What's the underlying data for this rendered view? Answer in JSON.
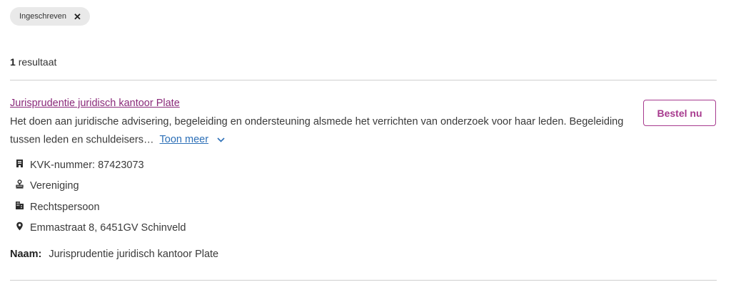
{
  "filter_chip": {
    "label": "Ingeschreven",
    "remove_symbol": "✕"
  },
  "results": {
    "count": "1",
    "label": "resultaat"
  },
  "result": {
    "title": "Jurisprudentie juridisch kantoor Plate",
    "description": "Het doen aan juridische advisering, begeleiding en ondersteuning alsmede het verrichten van onderzoek voor haar leden. Begeleiding tussen leden en schuldeisers…",
    "toon_meer": "Toon meer",
    "order_button": "Bestel nu",
    "meta": [
      {
        "icon": "kvk-document-icon",
        "text": "KVK-nummer: 87423073"
      },
      {
        "icon": "stamp-icon",
        "text": "Vereniging"
      },
      {
        "icon": "building-icon",
        "text": "Rechtspersoon"
      },
      {
        "icon": "location-pin-icon",
        "text": "Emmastraat 8, 6451GV Schinveld"
      }
    ],
    "naam_label": "Naam:",
    "naam_value": "Jurisprudentie juridisch kantoor Plate"
  },
  "colors": {
    "accent": "#a73a8e",
    "title_link": "#8a2a7a",
    "link": "#2c6fb7"
  }
}
